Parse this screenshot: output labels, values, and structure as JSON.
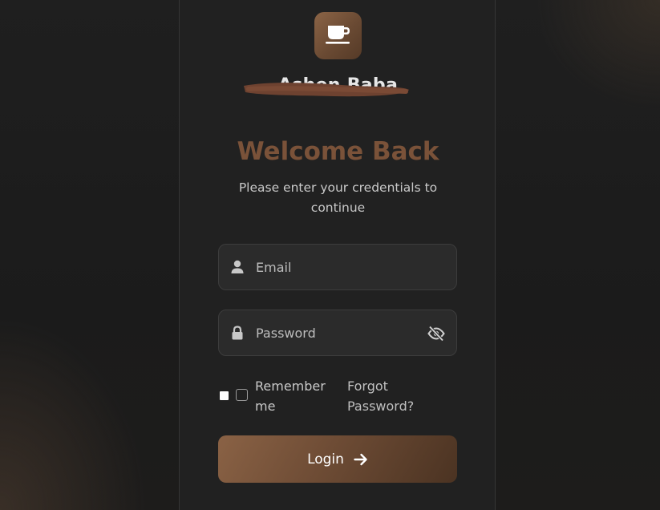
{
  "brand": {
    "name": "Ashen Baba",
    "logo_icon": "coffee-cup-icon",
    "redacted": true
  },
  "heading": {
    "title": "Welcome Back",
    "subtitle": "Please enter your credentials to continue"
  },
  "form": {
    "email": {
      "icon": "user-icon",
      "placeholder": "Email",
      "value": ""
    },
    "password": {
      "icon": "lock-icon",
      "placeholder": "Password",
      "value": "",
      "toggle_icon": "eye-slash-icon"
    },
    "remember_label": "Remember me",
    "remember_checked": false,
    "forgot_label": "Forgot Password?",
    "login_label": "Login",
    "login_icon": "arrow-right-icon"
  },
  "colors": {
    "accent": "#7a5239",
    "button_start": "#8a6245",
    "button_end": "#4b3322",
    "card": "#212121",
    "background": "#1c1c1c"
  }
}
